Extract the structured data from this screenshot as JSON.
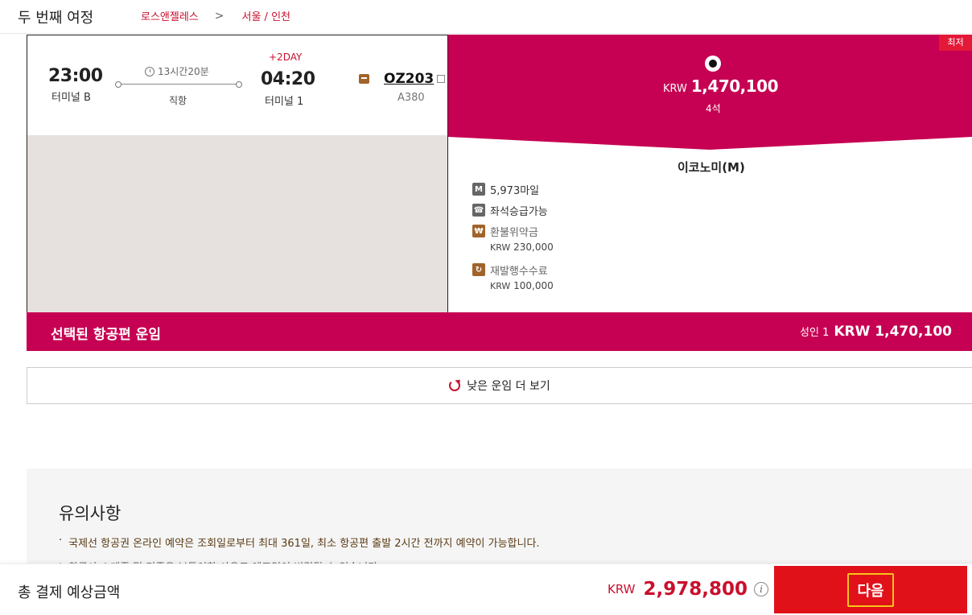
{
  "header": {
    "title": "두 번째 여정",
    "route_from": "로스앤젤레스",
    "route_sep": ">",
    "route_to": "서울 / 인천"
  },
  "flight": {
    "dep_time": "23:00",
    "dep_terminal": "터미널 B",
    "duration": "13시간20분",
    "stops": "직항",
    "plus_day": "+2DAY",
    "arr_time": "04:20",
    "arr_terminal": "터미널 1",
    "flight_no": "OZ203",
    "aircraft": "A380"
  },
  "fare": {
    "badge": "최저",
    "currency": "KRW",
    "amount": "1,470,100",
    "seats": "4석",
    "cabin": "이코노미(M)",
    "benefits": [
      {
        "icon": "M",
        "label": "5,973마일",
        "sub": ""
      },
      {
        "icon": "phone",
        "label": "좌석승급가능",
        "sub": ""
      },
      {
        "icon": "₩",
        "label": "환불위약금",
        "sub": "230,000",
        "sub_cur": "KRW"
      },
      {
        "icon": "refresh",
        "label": "재발행수수료",
        "sub": "100,000",
        "sub_cur": "KRW"
      }
    ],
    "colors": {
      "primary": "#c60052",
      "badge": "#e31937",
      "icon_brown": "#a0642a",
      "icon_gray": "#666666"
    }
  },
  "selected": {
    "label": "선택된 항공편 운임",
    "pax": "성인 1",
    "total": "KRW 1,470,100"
  },
  "more_button": {
    "label": "낮은 운임 더 보기"
  },
  "notice": {
    "title": "유의사항",
    "items": [
      "국제선 항공권 온라인 예약은 조회일로부터 최대 361일, 최소 항공편 출발 2시간 전까지 예약이 가능합니다.",
      "항공사 스케줄 및 기종은 부득이한 사유로 예고없이 변경될 수 있습니다."
    ]
  },
  "footer": {
    "label": "총 결제 예상금액",
    "currency": "KRW",
    "amount": "2,978,800",
    "next": "다음",
    "colors": {
      "next_bg": "#e1111a",
      "price": "#c8102e"
    }
  }
}
